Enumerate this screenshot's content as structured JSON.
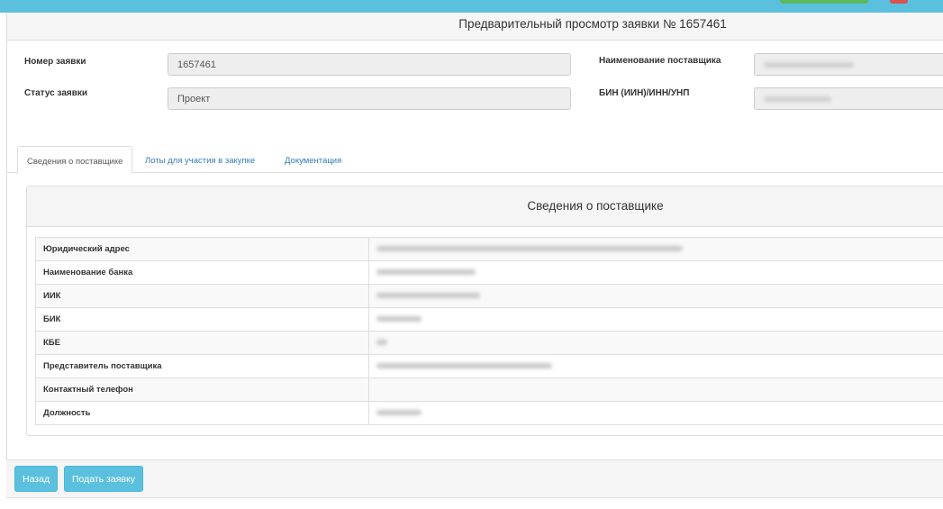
{
  "header": {
    "title": "Предварительный просмотр заявки № 1657461"
  },
  "form": {
    "app_number_label": "Номер заявки",
    "app_number_value": "1657461",
    "status_label": "Статус заявки",
    "status_value": "Проект",
    "supplier_name_label": "Наименование поставщика",
    "bin_label": "БИН (ИИН)/ИНН/УНП"
  },
  "tabs": [
    {
      "label": "Сведения о поставщике",
      "active": true
    },
    {
      "label": "Лоты для участия в закупке",
      "active": false
    },
    {
      "label": "Документация",
      "active": false
    }
  ],
  "supplier_info": {
    "title": "Сведения о поставщике",
    "rows": [
      {
        "label": "Юридический адрес"
      },
      {
        "label": "Наименование банка"
      },
      {
        "label": "ИИК"
      },
      {
        "label": "БИК"
      },
      {
        "label": "КБЕ"
      },
      {
        "label": "Представитель поставщика"
      },
      {
        "label": "Контактный телефон"
      },
      {
        "label": "Должность"
      }
    ]
  },
  "footer": {
    "back_label": "Назад",
    "submit_label": "Подать заявку"
  },
  "colors": {
    "accent": "#5bc0de",
    "link": "#337ab7",
    "success": "#5cb85c",
    "danger": "#d9534f"
  }
}
